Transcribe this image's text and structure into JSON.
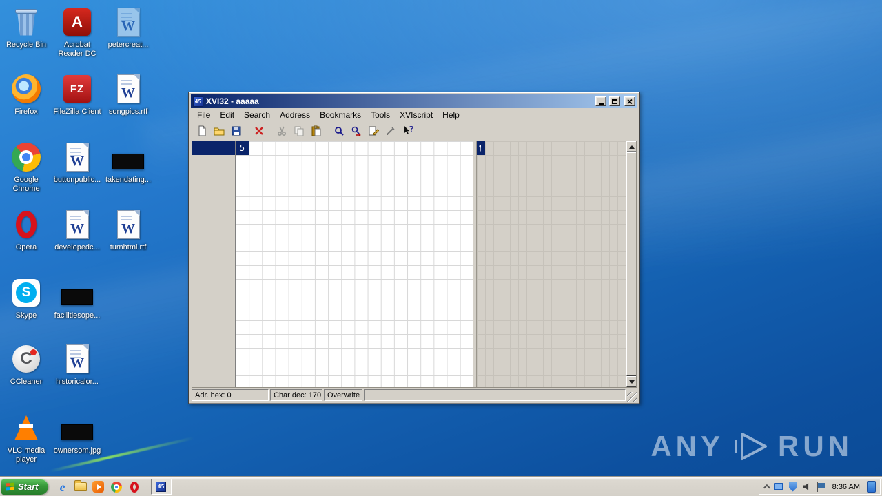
{
  "desktop": {
    "icons": [
      {
        "label": "Recycle Bin"
      },
      {
        "label": "Acrobat Reader DC",
        "glyph": "A"
      },
      {
        "label": "petercreat...",
        "glyph": "W"
      },
      {
        "label": "Firefox"
      },
      {
        "label": "FileZilla Client",
        "glyph": "FZ"
      },
      {
        "label": "songpics.rtf",
        "glyph": "W"
      },
      {
        "label": "Google Chrome"
      },
      {
        "label": "buttonpublic...",
        "glyph": "W"
      },
      {
        "label": "takendating..."
      },
      {
        "label": "Opera"
      },
      {
        "label": "developedc...",
        "glyph": "W"
      },
      {
        "label": "turnhtml.rtf",
        "glyph": "W"
      },
      {
        "label": "Skype",
        "glyph": "S"
      },
      {
        "label": "facilitiesope..."
      },
      {
        "label": "CCleaner",
        "glyph": "C"
      },
      {
        "label": "historicalor...",
        "glyph": "W"
      },
      {
        "label": "VLC media player"
      },
      {
        "label": "ownersom.jpg"
      }
    ],
    "watermark": {
      "left": "ANY",
      "right": "RUN"
    }
  },
  "xvi32": {
    "icon_glyph": "45",
    "title": "XVI32 - aaaaa",
    "menu": [
      "File",
      "Edit",
      "Search",
      "Address",
      "Bookmarks",
      "Tools",
      "XVIscript",
      "Help"
    ],
    "toolbar_icons": [
      "new-file",
      "open-file",
      "save-file",
      "delete",
      "cut",
      "copy",
      "paste",
      "find",
      "find-next",
      "edit-address",
      "insert",
      "context-help"
    ],
    "editor": {
      "hex_selected": "5",
      "text_selected": "¶"
    },
    "status": {
      "address": "Adr. hex: 0",
      "char": "Char dec: 170",
      "mode": "Overwrite"
    }
  },
  "taskbar": {
    "start": "Start",
    "quick_launch": {
      "ie_glyph": "e"
    },
    "clock": "8:36 AM"
  },
  "colors": {
    "titlebar_left": "#0a246a",
    "titlebar_right": "#a6caf0",
    "selection": "#0a246a",
    "window_face": "#d4d0c8"
  }
}
